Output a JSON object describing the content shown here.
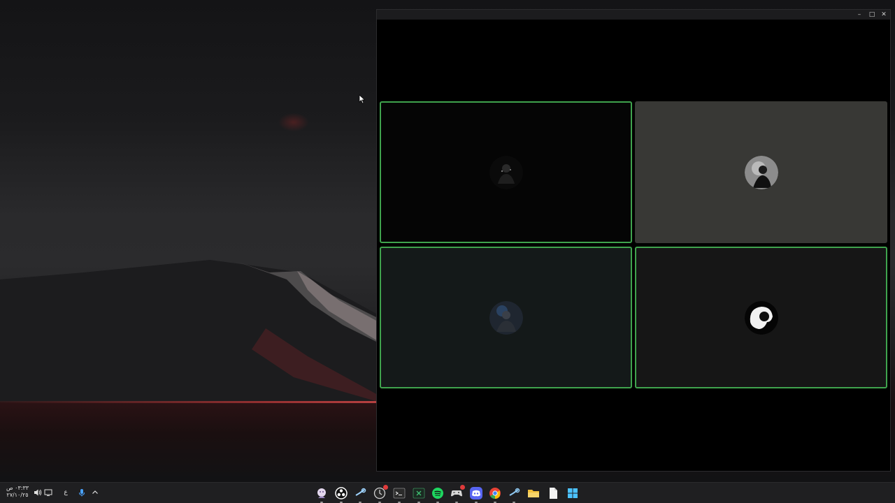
{
  "window": {
    "controls": {
      "minimize": "–",
      "maximize": "□",
      "close": "✕"
    }
  },
  "call": {
    "tiles": [
      {
        "position": "top-left",
        "speaking": true,
        "background": "#050505",
        "avatar": "dark-figure"
      },
      {
        "position": "top-right",
        "speaking": false,
        "background": "#383835",
        "avatar": "figure-light-circle"
      },
      {
        "position": "bottom-left",
        "speaking": true,
        "background": "#141919",
        "avatar": "dark-blue-figure"
      },
      {
        "position": "bottom-right",
        "speaking": true,
        "background": "#161616",
        "avatar": "white-profile-silhouette"
      }
    ],
    "speaking_color": "#3fa34d"
  },
  "taskbar": {
    "clock": {
      "time": "٠٣:٣٣ ص",
      "date": "٢٧/١٠/٢٥"
    },
    "language": "ع",
    "tray_icons": [
      "volume-icon",
      "display-icon",
      "microphone-icon",
      "chevron-up-icon"
    ],
    "apps": [
      {
        "name": "anime-app-icon",
        "color": "#d8cde6"
      },
      {
        "name": "obs-icon",
        "color": "#ffffff"
      },
      {
        "name": "steam-icon",
        "color": "#1b6fa8"
      },
      {
        "name": "app-with-badge-icon",
        "color": "#cccccc",
        "badge": true
      },
      {
        "name": "terminal-icon",
        "color": "#444444"
      },
      {
        "name": "terminal-x-icon",
        "color": "#2e7d4f"
      },
      {
        "name": "spotify-icon",
        "color": "#1ed760"
      },
      {
        "name": "game-controller-icon",
        "color": "#cccccc",
        "badge": true
      },
      {
        "name": "discord-icon",
        "color": "#5865f2"
      },
      {
        "name": "chrome-icon",
        "color": "#e84235"
      },
      {
        "name": "steam-alt-icon",
        "color": "#66c0f4"
      },
      {
        "name": "file-explorer-icon",
        "color": "#f3c13a"
      },
      {
        "name": "document-icon",
        "color": "#f2f2f2"
      },
      {
        "name": "windows-start-icon",
        "color": "#2ea0f0"
      }
    ]
  }
}
